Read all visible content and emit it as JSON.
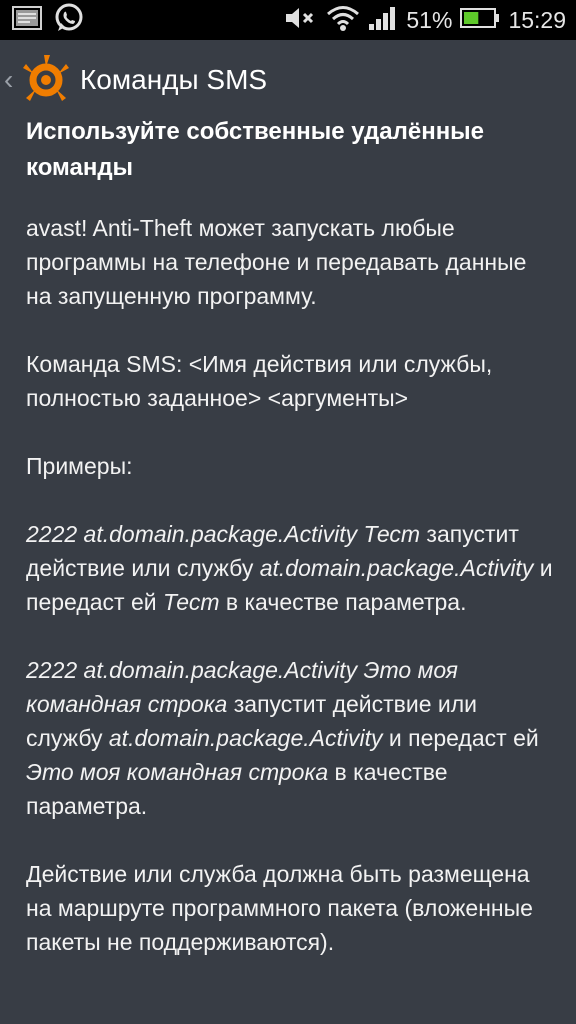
{
  "status_bar": {
    "battery_percent": "51%",
    "time": "15:29",
    "icons": [
      "image-notification-icon",
      "whatsapp-icon",
      "mute-icon",
      "wifi-icon",
      "signal-icon",
      "battery-icon"
    ],
    "battery_level": 0.51,
    "battery_color": "#5ec82a"
  },
  "action_bar": {
    "title": "Команды SMS",
    "logo": "avast-logo",
    "back_icon": "chevron-left-icon",
    "accent": "#f07d00"
  },
  "content": {
    "heading": "Используйте собственные удалённые команды",
    "p1": "avast! Anti-Theft может запускать любые программы на телефоне и передавать данные на запущенную программу.",
    "p2": "Команда SMS: <Имя действия или службы, полностью заданное> <аргументы>",
    "p3": "Примеры:",
    "ex1": {
      "cmd": "2222 at.domain.package.Activity Тест",
      "t1": " запустит действие или службу ",
      "pkg": "at.domain.package.Activity",
      "t2": " и передаст ей ",
      "arg": "Тест",
      "t3": " в качестве параметра."
    },
    "ex2": {
      "cmd": "2222 at.domain.package.Activity Это моя командная строка",
      "t1": " запустит действие или службу ",
      "pkg": "at.domain.package.Activity",
      "t2": " и передаст ей ",
      "arg": "Это моя командная строка",
      "t3": " в качестве параметра."
    },
    "p4": "Действие или служба должна быть размещена на маршруте программного пакета (вложенные пакеты не поддерживаются)."
  }
}
